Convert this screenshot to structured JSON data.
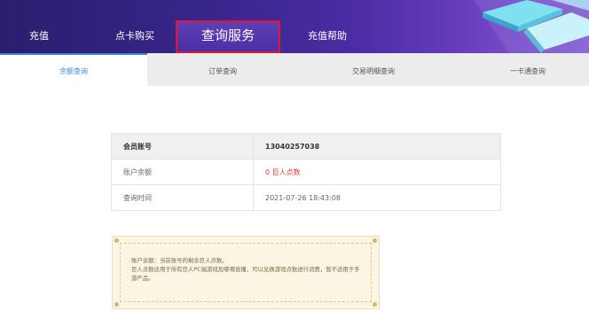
{
  "nav": {
    "items": [
      {
        "label": "充值"
      },
      {
        "label": "点卡购买"
      },
      {
        "label": "查询服务"
      },
      {
        "label": "充值帮助"
      }
    ]
  },
  "tabs": [
    {
      "label": "余额查询",
      "active": true
    },
    {
      "label": "订单查询",
      "active": false
    },
    {
      "label": "交易明细查询",
      "active": false
    },
    {
      "label": "一卡通查询",
      "active": false
    }
  ],
  "account_info": {
    "rows": [
      {
        "label": "会员账号",
        "value": "13040257038"
      },
      {
        "label": "账户余额",
        "value": "0 巨人点数"
      },
      {
        "label": "查询时间",
        "value": "2021-07-26 18:43:08"
      }
    ]
  },
  "notice": {
    "line1": "账户余额：当前账号的剩余巨人点数。",
    "line2": "巨人点数适用于所有巨人PC端游戏及哪哪直播，可以兑换游戏点数进行消费，暂不适用于手游产品。"
  },
  "colors": {
    "nav_bg": "#38258a",
    "active_outline": "#e0182d",
    "active_tab": "#3a8ad6",
    "balance_red": "#e2392f",
    "notice_bg": "#fbf6e3"
  }
}
